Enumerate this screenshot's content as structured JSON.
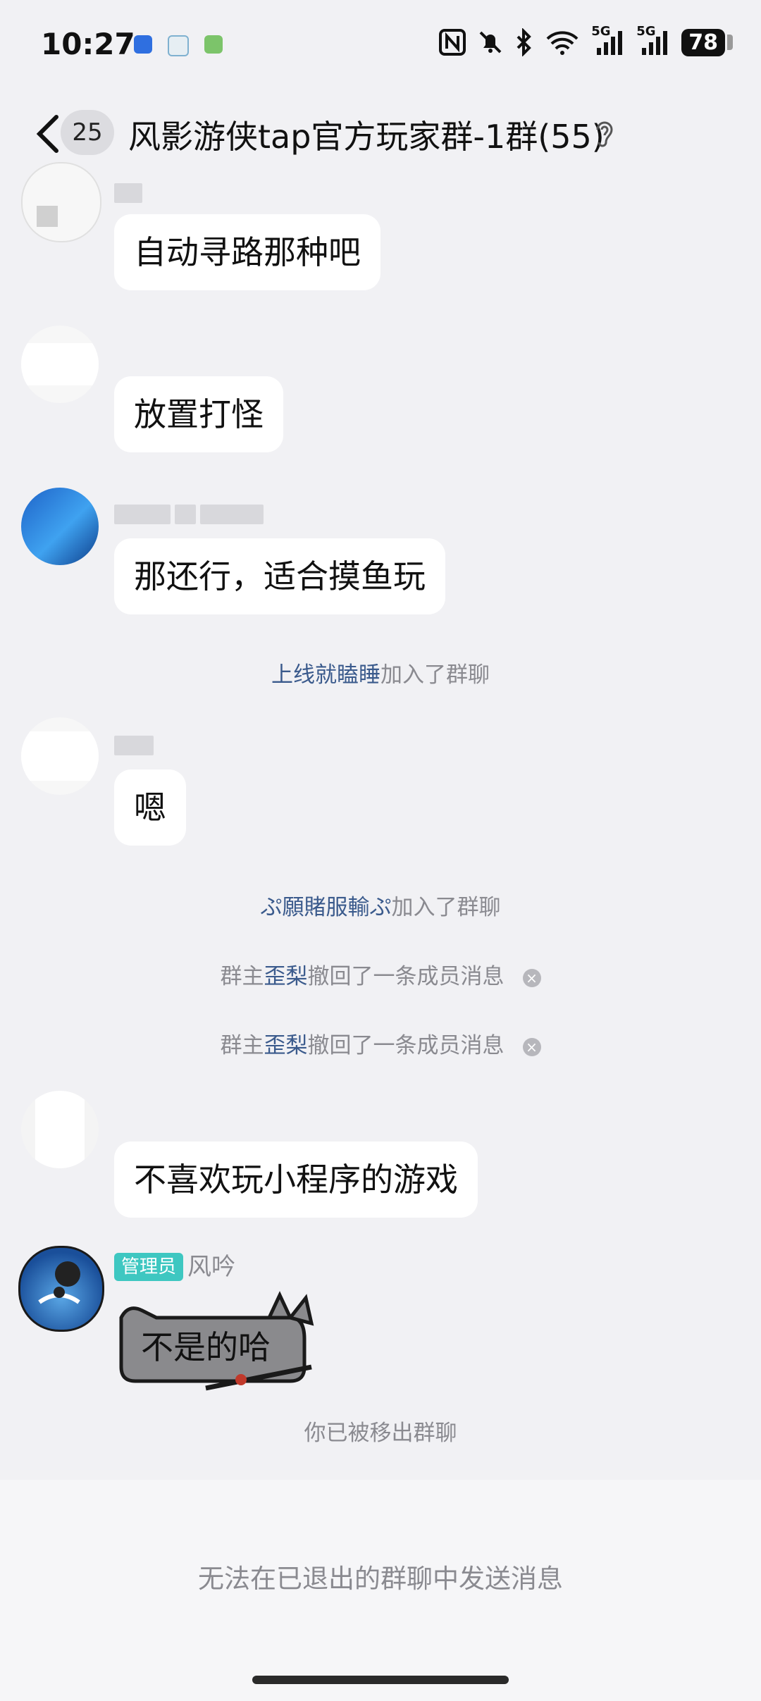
{
  "status_bar": {
    "time": "10:27",
    "battery": "78",
    "signal_1": "5G",
    "signal_2": "5G"
  },
  "header": {
    "unread_count": "25",
    "title": "风影游侠tap官方玩家群-1群(55)"
  },
  "messages": [
    {
      "type": "text",
      "text": "自动寻路那种吧"
    },
    {
      "type": "text",
      "text": "放置打怪"
    },
    {
      "type": "text",
      "text": "那还行，适合摸鱼玩"
    },
    {
      "type": "system",
      "highlight": "上线就瞌睡",
      "suffix": "加入了群聊"
    },
    {
      "type": "text",
      "text": "嗯"
    },
    {
      "type": "system",
      "highlight": "ぷ願賭服輸ぷ",
      "suffix": "加入了群聊"
    },
    {
      "type": "system_revoke",
      "prefix": "群主",
      "highlight": "歪梨",
      "suffix": "撤回了一条成员消息"
    },
    {
      "type": "system_revoke",
      "prefix": "群主",
      "highlight": "歪梨",
      "suffix": "撤回了一条成员消息"
    },
    {
      "type": "text",
      "text": "不喜欢玩小程序的游戏"
    },
    {
      "type": "sticker",
      "role": "管理员",
      "sender": "风吟",
      "text": "不是的哈"
    }
  ],
  "removed_notice": "你已被移出群聊",
  "bottom_notice": "无法在已退出的群聊中发送消息",
  "colors": {
    "background": "#f1f1f4",
    "bubble": "#ffffff",
    "highlight_name": "#3a5a8c",
    "admin_tag": "#3ec7c1",
    "system_text": "#8a8a90"
  }
}
